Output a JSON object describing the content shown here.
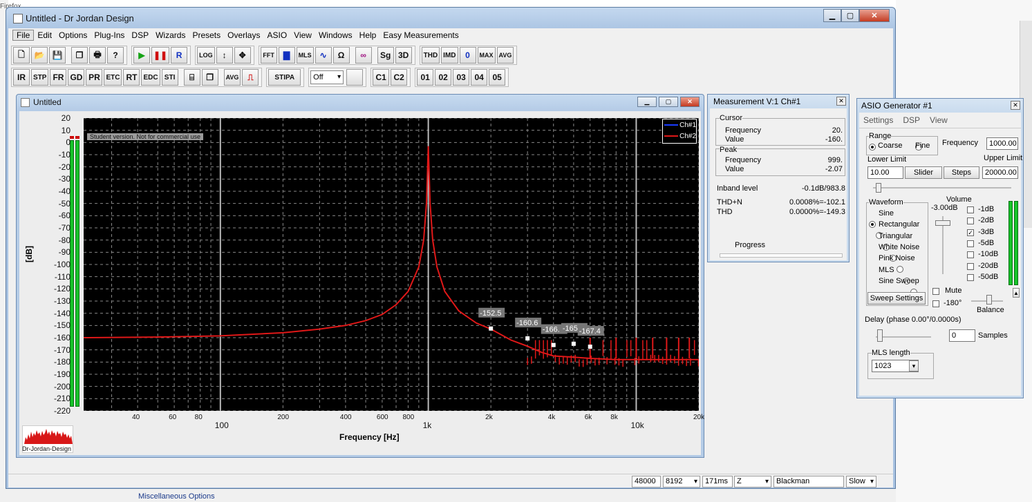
{
  "desktop": {
    "browser_fragment": "Firefox"
  },
  "main_window": {
    "title": "Untitled - Dr Jordan Design"
  },
  "menu": [
    "File",
    "Edit",
    "Options",
    "Plug-Ins",
    "DSP",
    "Wizards",
    "Presets",
    "Overlays",
    "ASIO",
    "View",
    "Windows",
    "Help",
    "Easy Measurements"
  ],
  "toolbar1": {
    "transport": [
      "▶",
      "❚❚",
      "R"
    ],
    "buttons": [
      "LOG",
      "FFT",
      "MLS",
      "Sg",
      "3D",
      "THD",
      "IMD",
      "0",
      "MAX",
      "AVG"
    ]
  },
  "toolbar2": {
    "buttons": [
      "IR",
      "STP",
      "FR",
      "GD",
      "PR",
      "ETC",
      "RT",
      "EDC",
      "STI"
    ],
    "avg": "AVG",
    "stipa": "STIPA",
    "select_value": "Off",
    "channels": [
      "C1",
      "C2"
    ],
    "presets": [
      "01",
      "02",
      "03",
      "04",
      "05"
    ]
  },
  "child_window": {
    "title": "Untitled",
    "student_notice": "Student version. Not for commercial use",
    "logo_text": "Dr-Jordan-Design"
  },
  "chart_data": {
    "type": "line",
    "xscale": "log",
    "xlabel": "Frequency [Hz]",
    "ylabel": "[dB]",
    "ylim": [
      -220,
      20
    ],
    "xlim": [
      22,
      20000
    ],
    "y_ticks": [
      20,
      10,
      0,
      -10,
      -20,
      -30,
      -40,
      -50,
      -60,
      -70,
      -80,
      -90,
      -100,
      -110,
      -120,
      -130,
      -140,
      -150,
      -160,
      -170,
      -180,
      -190,
      -200,
      -210,
      -220
    ],
    "x_minor_labels": [
      {
        "v": 40,
        "t": "40"
      },
      {
        "v": 60,
        "t": "60"
      },
      {
        "v": 80,
        "t": "80"
      },
      {
        "v": 200,
        "t": "200"
      },
      {
        "v": 400,
        "t": "400"
      },
      {
        "v": 600,
        "t": "600"
      },
      {
        "v": 800,
        "t": "800"
      },
      {
        "v": 2000,
        "t": "2k"
      },
      {
        "v": 4000,
        "t": "4k"
      },
      {
        "v": 6000,
        "t": "6k"
      },
      {
        "v": 8000,
        "t": "8k"
      },
      {
        "v": 20000,
        "t": "20k"
      }
    ],
    "x_major_labels": [
      {
        "v": 100,
        "t": "100"
      },
      {
        "v": 1000,
        "t": "1k"
      },
      {
        "v": 10000,
        "t": "10k"
      }
    ],
    "grid": true,
    "legend": {
      "placement": "top-right",
      "entries": [
        "Ch#1",
        "Ch#2"
      ]
    },
    "series": [
      {
        "name": "Ch#2",
        "color": "#e01818",
        "points": [
          [
            22,
            -160
          ],
          [
            50,
            -159.5
          ],
          [
            100,
            -158.5
          ],
          [
            200,
            -156
          ],
          [
            300,
            -153
          ],
          [
            400,
            -150
          ],
          [
            500,
            -146
          ],
          [
            600,
            -141
          ],
          [
            700,
            -133
          ],
          [
            800,
            -122
          ],
          [
            900,
            -102
          ],
          [
            950,
            -80
          ],
          [
            980,
            -50
          ],
          [
            1000,
            -3
          ],
          [
            1020,
            -50
          ],
          [
            1050,
            -80
          ],
          [
            1100,
            -102
          ],
          [
            1200,
            -122
          ],
          [
            1400,
            -138
          ],
          [
            1700,
            -148
          ],
          [
            2000,
            -153
          ],
          [
            2500,
            -162
          ],
          [
            3000,
            -167
          ],
          [
            3500,
            -172
          ],
          [
            4000,
            -175
          ],
          [
            5000,
            -176
          ],
          [
            6000,
            -177
          ],
          [
            8000,
            -178
          ],
          [
            10000,
            -178
          ],
          [
            20000,
            -178
          ]
        ]
      }
    ],
    "peak_markers": [
      {
        "f": 2000,
        "db": -152.5,
        "label": "-152.5"
      },
      {
        "f": 3000,
        "db": -160.6,
        "label": "-160.6"
      },
      {
        "f": 4000,
        "db": -166,
        "label": "-166."
      },
      {
        "f": 5000,
        "db": -165,
        "label": "-165"
      },
      {
        "f": 6000,
        "db": -167.4,
        "label": "-167.4"
      }
    ]
  },
  "measurement": {
    "title": "Measurement V:1 Ch#1",
    "cursor": {
      "label": "Cursor",
      "freq_label": "Frequency",
      "freq": "20.",
      "value_label": "Value",
      "value": "-160."
    },
    "peak": {
      "label": "Peak",
      "freq_label": "Frequency",
      "freq": "999.",
      "value_label": "Value",
      "value": "-2.07"
    },
    "inband_label": "Inband level",
    "inband_value": "-0.1dB/983.8",
    "thdn_label": "THD+N",
    "thdn_value": "0.0008%=-102.1",
    "thd_label": "THD",
    "thd_value": "0.0000%=-149.3",
    "progress_label": "Progress"
  },
  "asio": {
    "title": "ASIO Generator #1",
    "menu": [
      "Settings",
      "DSP",
      "View"
    ],
    "range_label": "Range",
    "coarse": "Coarse",
    "fine": "Fine",
    "frequency_label": "Frequency",
    "frequency": "1000.00",
    "lower_limit_label": "Lower Limit",
    "lower_limit": "10.00",
    "upper_limit_label": "Upper Limit",
    "upper_limit": "20000.00",
    "slider_btn": "Slider",
    "steps_btn": "Steps",
    "waveform_label": "Waveform",
    "waveforms": [
      "Sine",
      "Rectangular",
      "Triangular",
      "White Noise",
      "Pink Noise",
      "MLS",
      "Sine Sweep"
    ],
    "selected_waveform": "Sine",
    "sweep_settings": "Sweep Settings",
    "volume_label": "Volume",
    "volume_value": "-3.00dB",
    "volume_steps": [
      "-1dB",
      "-2dB",
      "-3dB",
      "-5dB",
      "-10dB",
      "-20dB",
      "-50dB"
    ],
    "volume_checked": "-3dB",
    "mute": "Mute",
    "invert": "-180°",
    "balance": "Balance",
    "delay_label": "Delay (phase  0.00°/0.0000s)",
    "delay_samples": "0",
    "samples_label": "Samples",
    "mls_label": "MLS length",
    "mls_value": "1023"
  },
  "status": {
    "rate": "48000",
    "fft": "8192",
    "time": "171ms",
    "zoom": "Z",
    "window": "Blackman",
    "speed": "Slow"
  },
  "misc_tab": "Miscellaneous Options",
  "colors": {
    "ch1": "#1a3cff",
    "ch2": "#e01818",
    "meter": "#17c42a"
  }
}
